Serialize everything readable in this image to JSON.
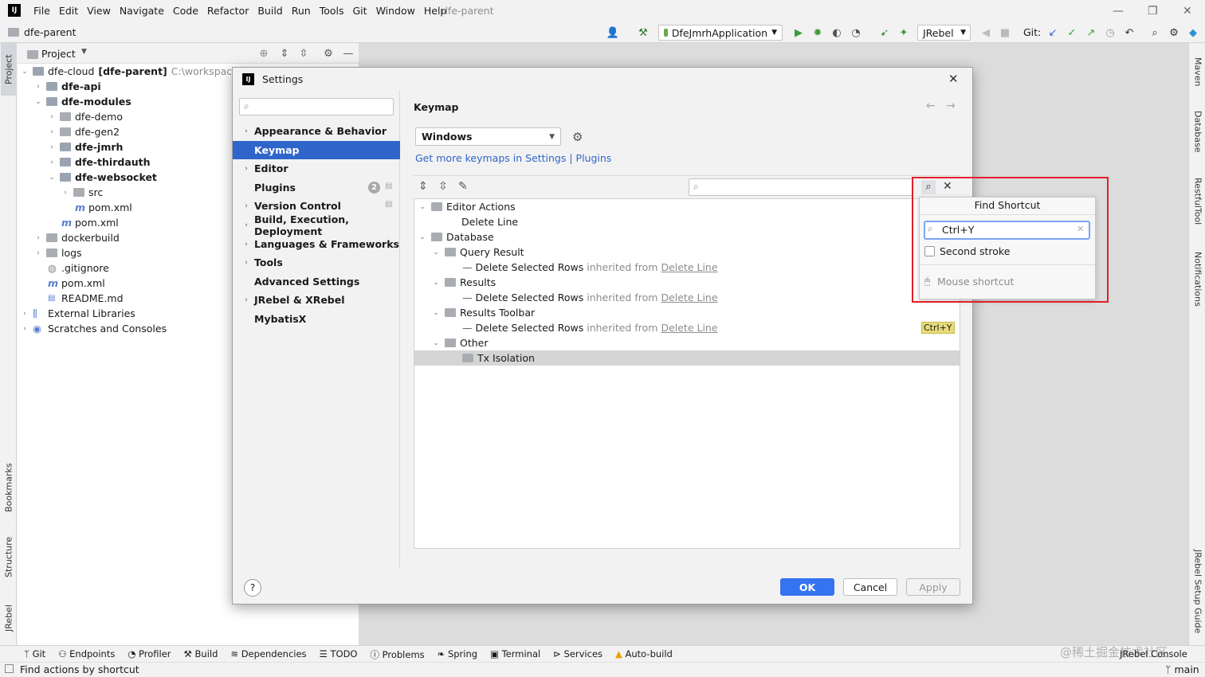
{
  "menubar": {
    "logo": "IJ",
    "items": [
      "File",
      "Edit",
      "View",
      "Navigate",
      "Code",
      "Refactor",
      "Build",
      "Run",
      "Tools",
      "Git",
      "Window",
      "Help"
    ],
    "project_title": "dfe-parent"
  },
  "navbar": {
    "breadcrumb": "dfe-parent",
    "run_config": "DfeJmrhApplication",
    "jrebel_select": "JRebel",
    "git_label": "Git:"
  },
  "left_strip": {
    "project": "Project",
    "bookmarks": "Bookmarks",
    "structure": "Structure",
    "jrebel": "JRebel"
  },
  "right_strip": {
    "maven": "Maven",
    "database": "Database",
    "restful": "RestfulTool",
    "notifications": "Notifications",
    "jrebel_guide": "JRebel Setup Guide"
  },
  "project_panel": {
    "title": "Project",
    "root_name": "dfe-cloud",
    "root_suffix": "[dfe-parent]",
    "root_path": "C:\\workspace\\dfe",
    "items": [
      {
        "label": "dfe-api"
      },
      {
        "label": "dfe-modules"
      },
      {
        "label": "dfe-demo"
      },
      {
        "label": "dfe-gen2"
      },
      {
        "label": "dfe-jmrh"
      },
      {
        "label": "dfe-thirdauth"
      },
      {
        "label": "dfe-websocket"
      },
      {
        "label": "src"
      },
      {
        "label": "pom.xml"
      },
      {
        "label": "pom.xml"
      },
      {
        "label": "dockerbuild"
      },
      {
        "label": "logs"
      },
      {
        "label": ".gitignore"
      },
      {
        "label": "pom.xml"
      },
      {
        "label": "README.md"
      },
      {
        "label": "External Libraries"
      },
      {
        "label": "Scratches and Consoles"
      }
    ]
  },
  "dialog": {
    "title": "Settings",
    "search_placeholder": "",
    "nav": [
      {
        "label": "Appearance & Behavior"
      },
      {
        "label": "Keymap"
      },
      {
        "label": "Editor"
      },
      {
        "label": "Plugins",
        "badge": "2"
      },
      {
        "label": "Version Control"
      },
      {
        "label": "Build, Execution, Deployment"
      },
      {
        "label": "Languages & Frameworks"
      },
      {
        "label": "Tools"
      },
      {
        "label": "Advanced Settings"
      },
      {
        "label": "JRebel & XRebel"
      },
      {
        "label": "MybatisX"
      }
    ],
    "section_title": "Keymap",
    "keymap_value": "Windows",
    "more_link": "Get more keymaps in Settings | Plugins",
    "tree": [
      {
        "label": "Editor Actions"
      },
      {
        "label": "Delete Line"
      },
      {
        "label": "Database"
      },
      {
        "label": "Query Result"
      },
      {
        "label": "Delete Selected Rows",
        "inherited": "inherited from",
        "link": "Delete Line"
      },
      {
        "label": "Results"
      },
      {
        "label": "Delete Selected Rows",
        "inherited": "inherited from",
        "link": "Delete Line"
      },
      {
        "label": "Results Toolbar"
      },
      {
        "label": "Delete Selected Rows",
        "inherited": "inherited from",
        "link": "Delete Line",
        "shortcut": "Ctrl+Y"
      },
      {
        "label": "Other"
      },
      {
        "label": "Tx Isolation"
      }
    ],
    "buttons": {
      "ok": "OK",
      "cancel": "Cancel",
      "apply": "Apply",
      "help": "?"
    }
  },
  "find_shortcut": {
    "title": "Find Shortcut",
    "value": "Ctrl+Y",
    "second_stroke": "Second stroke",
    "mouse_shortcut": "Mouse shortcut"
  },
  "bottom_tabs": [
    "Git",
    "Endpoints",
    "Profiler",
    "Build",
    "Dependencies",
    "TODO",
    "Problems",
    "Spring",
    "Terminal",
    "Services",
    "Auto-build"
  ],
  "bottom_right": "JRebel Console",
  "watermark": "@稀土掘金技术社区",
  "statusbar": {
    "message": "Find actions by shortcut",
    "branch": "main"
  },
  "colors": {
    "selection": "#2f65ca",
    "primary_button": "#3574f0",
    "highlight_box": "#e0202a",
    "shortcut_badge": "#e8dc7a",
    "link": "#2f65ca"
  }
}
